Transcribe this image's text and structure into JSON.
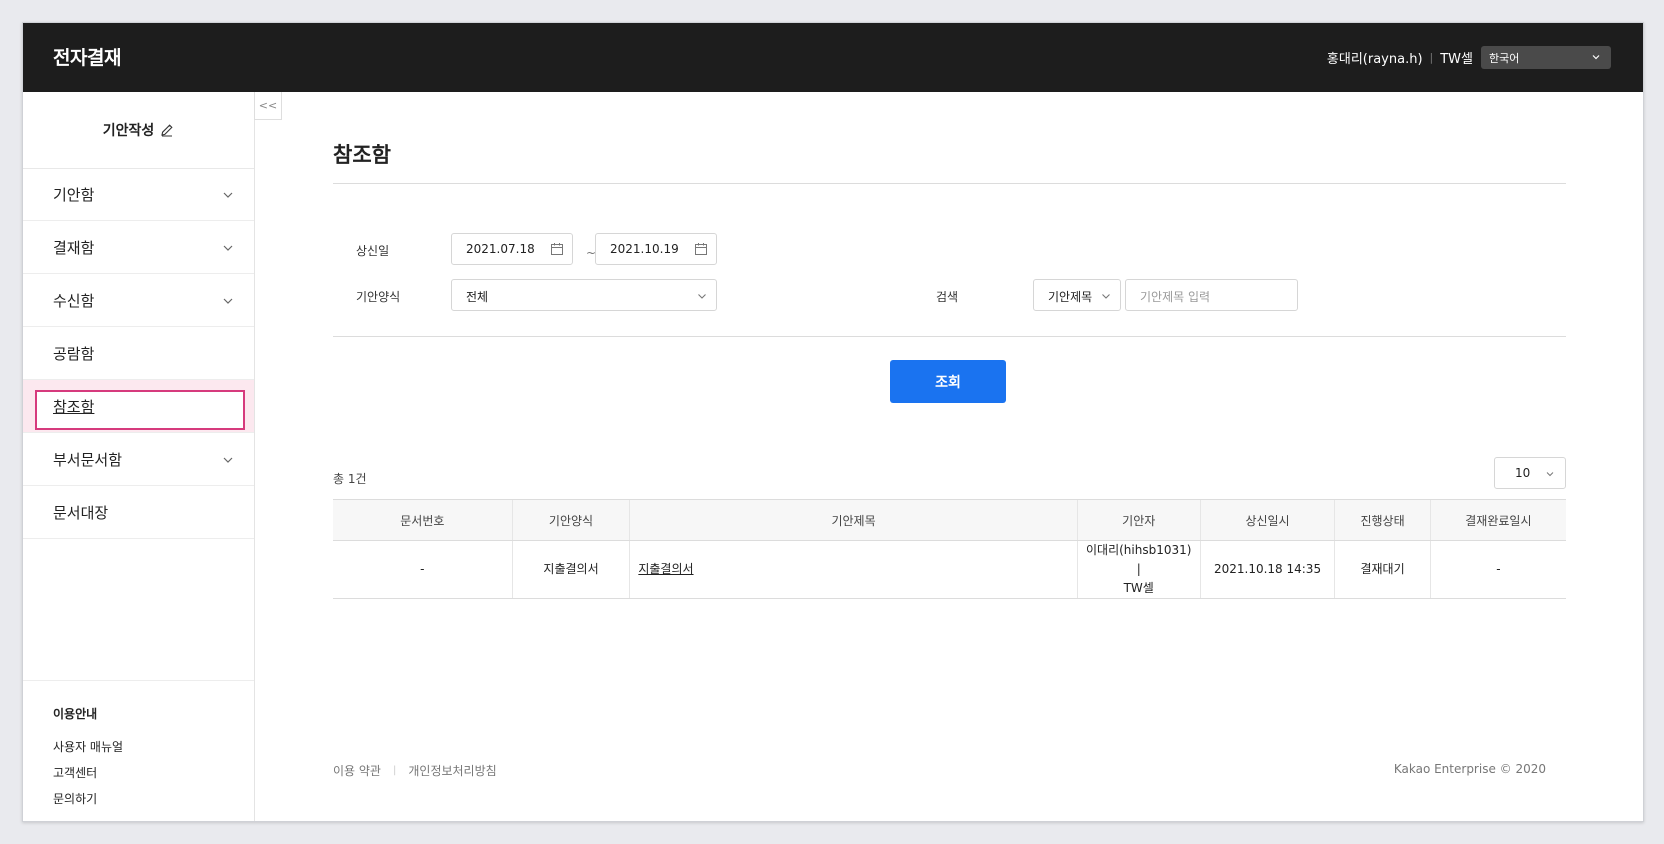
{
  "header": {
    "app_title": "전자결재",
    "user_name": "홍대리(rayna.h)",
    "separator": "|",
    "user_dept": "TW셀",
    "language": "한국어"
  },
  "sidebar": {
    "write_label": "기안작성",
    "collapse_label": "<<",
    "items": [
      {
        "label": "기안함",
        "expandable": true
      },
      {
        "label": "결재함",
        "expandable": true
      },
      {
        "label": "수신함",
        "expandable": true
      },
      {
        "label": "공람함",
        "expandable": false
      },
      {
        "label": "참조함",
        "expandable": false,
        "active": true
      },
      {
        "label": "부서문서함",
        "expandable": true
      },
      {
        "label": "문서대장",
        "expandable": false
      }
    ],
    "guide": {
      "title": "이용안내",
      "links": [
        "사용자 매뉴얼",
        "고객센터",
        "문의하기"
      ]
    }
  },
  "main": {
    "page_title": "참조함",
    "filters": {
      "date_label": "상신일",
      "date_from": "2021.07.18",
      "tilde": "~",
      "date_to": "2021.10.19",
      "form_label": "기안양식",
      "form_value": "전체",
      "search_label": "검색",
      "search_type": "기안제목",
      "search_placeholder": "기안제목 입력"
    },
    "search_button": "조회",
    "total_count": "총 1건",
    "page_size": "10",
    "table": {
      "columns": [
        "문서번호",
        "기안양식",
        "기안제목",
        "기안자",
        "상신일시",
        "진행상태",
        "결재완료일시"
      ],
      "rows": [
        {
          "doc_no": "-",
          "form": "지출결의서",
          "title": "지출결의서",
          "drafter_line1": "이대리(hihsb1031) |",
          "drafter_line2": "TW셀",
          "submitted": "2021.10.18 14:35",
          "status": "결재대기",
          "completed": "-"
        }
      ]
    }
  },
  "footer": {
    "terms": "이용 약관",
    "divider": "|",
    "privacy": "개인정보처리방침",
    "copyright": "Kakao Enterprise © 2020"
  },
  "colors": {
    "header_bg": "#1d1d1d",
    "primary_button": "#1a73f0",
    "active_highlight_border": "#d63a7d",
    "active_highlight_bg": "#fce8ef",
    "avatar": "#7fb3ee"
  }
}
